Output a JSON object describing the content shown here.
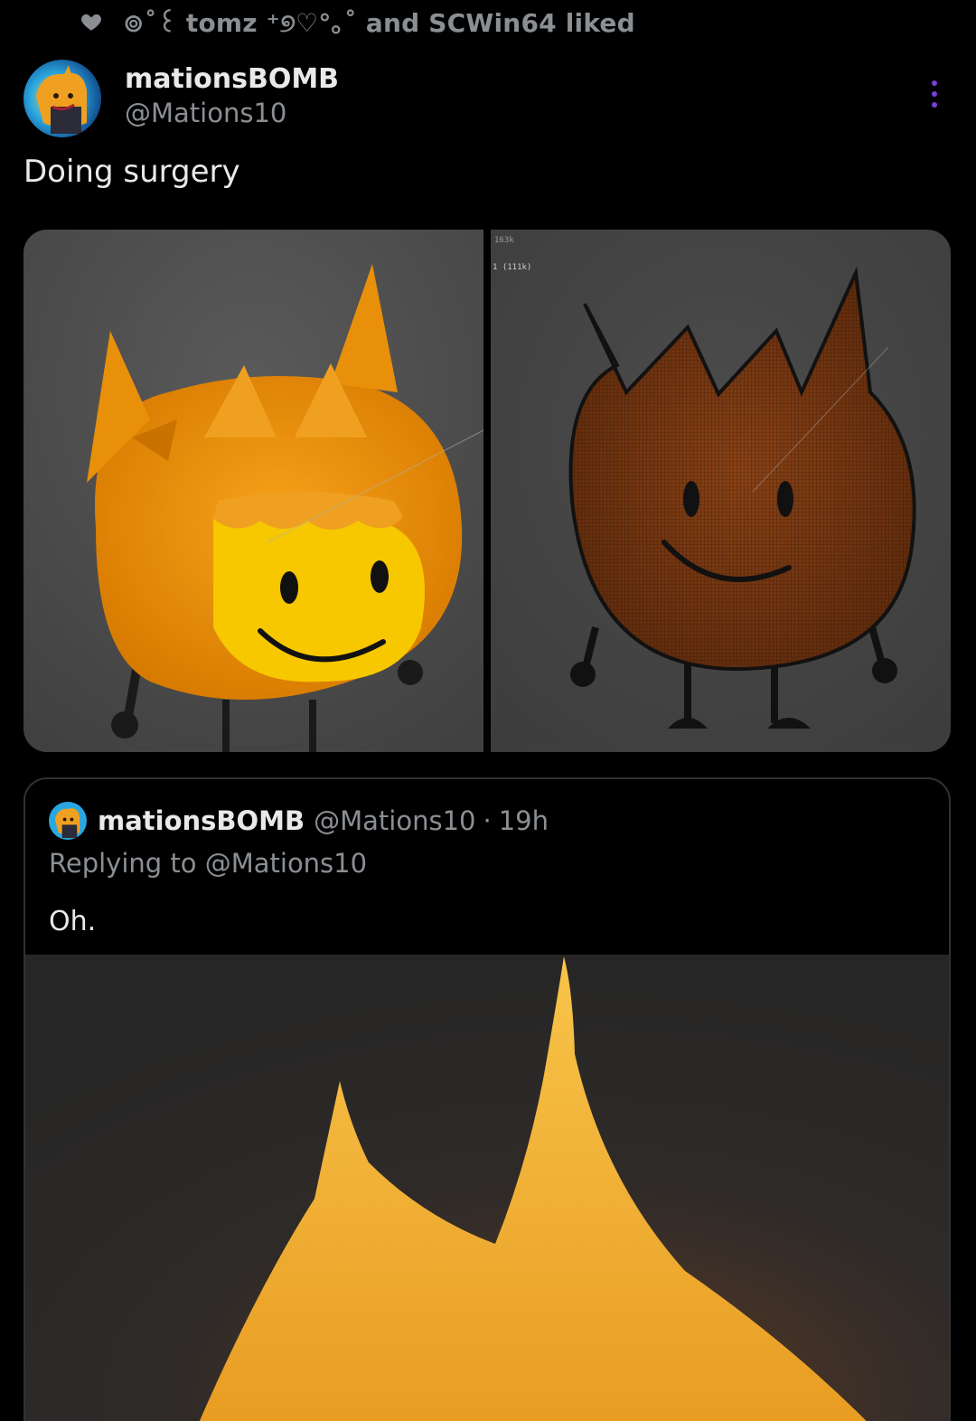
{
  "social_context": {
    "icon": "heart-icon",
    "text": "⊚˚꒰ tomz ⁺୭♡°｡˚ and SCWin64 liked"
  },
  "post": {
    "author": {
      "display_name": "mationsBOMB",
      "handle": "@Mations10",
      "avatar_icon": "avatar"
    },
    "more_icon": "more-vertical-icon",
    "text": "Doing surgery",
    "media": {
      "left_label": "",
      "right_overlay_line1": "163k",
      "right_overlay_line2": "1 (111k)"
    }
  },
  "quote": {
    "display_name": "mationsBOMB",
    "handle": "@Mations10",
    "separator": "·",
    "time": "19h",
    "replying_prefix": "Replying to ",
    "replying_mention": "@Mations10",
    "text": "Oh."
  },
  "colors": {
    "background": "#000000",
    "text_primary": "#e7e9ea",
    "text_secondary": "#8b8f93",
    "border": "#2f3336",
    "more_icon": "#7a3fd6"
  }
}
